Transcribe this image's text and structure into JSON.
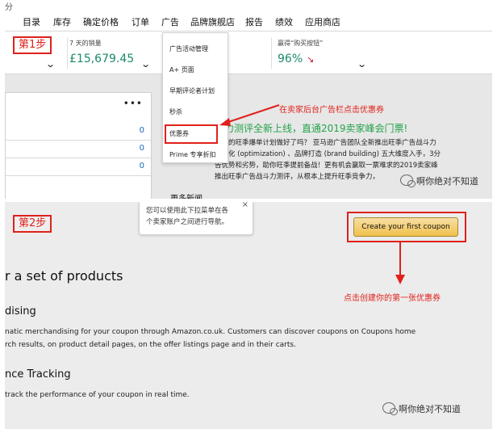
{
  "panel1": {
    "corner_glyph": "分",
    "nav": [
      "目录",
      "库存",
      "确定价格",
      "订单",
      "广告",
      "品牌旗舰店",
      "报告",
      "绩效",
      "应用商店"
    ],
    "step_label": "第1步",
    "metrics": {
      "sales_label": "7 天的销量",
      "sales_value": "£15,679.45",
      "buybox_label": "赢得“购买按钮”",
      "buybox_value": "96%"
    },
    "dropdown_items": [
      "广告活动管理",
      "A+ 页面",
      "早期评论者计划",
      "秒杀",
      "优惠券",
      "Prime 专享折扣"
    ],
    "left_card": {
      "menu": "•••",
      "rows": [
        "0",
        "0",
        "0"
      ]
    },
    "annotation": "在卖家后台广告栏点击优惠券",
    "news": {
      "title": "斗力测评全新上线，直通2019卖家峰会门票!",
      "lines": [
        "，你的旺季爆单计划做好了吗？ 亚马逊广告团队全新推出旺季广告战斗力",
        "、优化 (optimization) 、品牌打造 (brand building) 五大维度入手，3分",
        "告优势和劣势，助你旺季提前备战！更有机会赢取一票难求的2019卖家峰",
        "推出旺季广告战斗力测评，从根本上提升旺季竞争力，"
      ],
      "more": "更多新闻"
    },
    "watermark": "啊你绝对不知道"
  },
  "panel2": {
    "step_label": "第2步",
    "tooltip": [
      "您可以使用此下拉菜单在各",
      "个卖家账户之间进行导航。"
    ],
    "tooltip_close": "×",
    "create_button": "Create your first coupon",
    "annotation": "点击创建你的第一张优惠券",
    "heading": "r a set of products",
    "section1_title": "dising",
    "section1_lines": [
      "natic merchandising for your coupon through Amazon.co.uk. Customers can discover coupons on Coupons home",
      "rch results, on product detail pages, on the offer listings page and in their carts."
    ],
    "section2_title": "nce Tracking",
    "section2_line": "track the performance of your coupon in real time.",
    "watermark": "啊你绝对不知道"
  },
  "colors": {
    "annotation_red": "#e0211b",
    "metric_green": "#1b8a6b",
    "news_green": "#23a34a",
    "button_gold": "#f0c14b"
  }
}
